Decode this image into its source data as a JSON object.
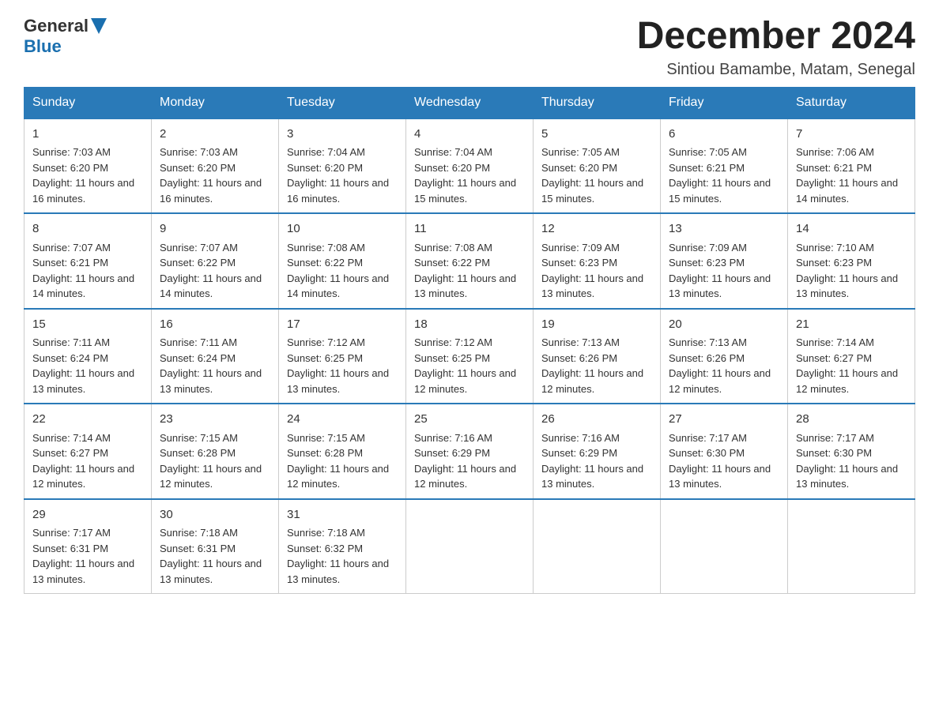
{
  "header": {
    "logo_general": "General",
    "logo_blue": "Blue",
    "month_title": "December 2024",
    "location": "Sintiou Bamambe, Matam, Senegal"
  },
  "columns": [
    "Sunday",
    "Monday",
    "Tuesday",
    "Wednesday",
    "Thursday",
    "Friday",
    "Saturday"
  ],
  "weeks": [
    [
      {
        "day": "1",
        "sunrise": "Sunrise: 7:03 AM",
        "sunset": "Sunset: 6:20 PM",
        "daylight": "Daylight: 11 hours and 16 minutes."
      },
      {
        "day": "2",
        "sunrise": "Sunrise: 7:03 AM",
        "sunset": "Sunset: 6:20 PM",
        "daylight": "Daylight: 11 hours and 16 minutes."
      },
      {
        "day": "3",
        "sunrise": "Sunrise: 7:04 AM",
        "sunset": "Sunset: 6:20 PM",
        "daylight": "Daylight: 11 hours and 16 minutes."
      },
      {
        "day": "4",
        "sunrise": "Sunrise: 7:04 AM",
        "sunset": "Sunset: 6:20 PM",
        "daylight": "Daylight: 11 hours and 15 minutes."
      },
      {
        "day": "5",
        "sunrise": "Sunrise: 7:05 AM",
        "sunset": "Sunset: 6:20 PM",
        "daylight": "Daylight: 11 hours and 15 minutes."
      },
      {
        "day": "6",
        "sunrise": "Sunrise: 7:05 AM",
        "sunset": "Sunset: 6:21 PM",
        "daylight": "Daylight: 11 hours and 15 minutes."
      },
      {
        "day": "7",
        "sunrise": "Sunrise: 7:06 AM",
        "sunset": "Sunset: 6:21 PM",
        "daylight": "Daylight: 11 hours and 14 minutes."
      }
    ],
    [
      {
        "day": "8",
        "sunrise": "Sunrise: 7:07 AM",
        "sunset": "Sunset: 6:21 PM",
        "daylight": "Daylight: 11 hours and 14 minutes."
      },
      {
        "day": "9",
        "sunrise": "Sunrise: 7:07 AM",
        "sunset": "Sunset: 6:22 PM",
        "daylight": "Daylight: 11 hours and 14 minutes."
      },
      {
        "day": "10",
        "sunrise": "Sunrise: 7:08 AM",
        "sunset": "Sunset: 6:22 PM",
        "daylight": "Daylight: 11 hours and 14 minutes."
      },
      {
        "day": "11",
        "sunrise": "Sunrise: 7:08 AM",
        "sunset": "Sunset: 6:22 PM",
        "daylight": "Daylight: 11 hours and 13 minutes."
      },
      {
        "day": "12",
        "sunrise": "Sunrise: 7:09 AM",
        "sunset": "Sunset: 6:23 PM",
        "daylight": "Daylight: 11 hours and 13 minutes."
      },
      {
        "day": "13",
        "sunrise": "Sunrise: 7:09 AM",
        "sunset": "Sunset: 6:23 PM",
        "daylight": "Daylight: 11 hours and 13 minutes."
      },
      {
        "day": "14",
        "sunrise": "Sunrise: 7:10 AM",
        "sunset": "Sunset: 6:23 PM",
        "daylight": "Daylight: 11 hours and 13 minutes."
      }
    ],
    [
      {
        "day": "15",
        "sunrise": "Sunrise: 7:11 AM",
        "sunset": "Sunset: 6:24 PM",
        "daylight": "Daylight: 11 hours and 13 minutes."
      },
      {
        "day": "16",
        "sunrise": "Sunrise: 7:11 AM",
        "sunset": "Sunset: 6:24 PM",
        "daylight": "Daylight: 11 hours and 13 minutes."
      },
      {
        "day": "17",
        "sunrise": "Sunrise: 7:12 AM",
        "sunset": "Sunset: 6:25 PM",
        "daylight": "Daylight: 11 hours and 13 minutes."
      },
      {
        "day": "18",
        "sunrise": "Sunrise: 7:12 AM",
        "sunset": "Sunset: 6:25 PM",
        "daylight": "Daylight: 11 hours and 12 minutes."
      },
      {
        "day": "19",
        "sunrise": "Sunrise: 7:13 AM",
        "sunset": "Sunset: 6:26 PM",
        "daylight": "Daylight: 11 hours and 12 minutes."
      },
      {
        "day": "20",
        "sunrise": "Sunrise: 7:13 AM",
        "sunset": "Sunset: 6:26 PM",
        "daylight": "Daylight: 11 hours and 12 minutes."
      },
      {
        "day": "21",
        "sunrise": "Sunrise: 7:14 AM",
        "sunset": "Sunset: 6:27 PM",
        "daylight": "Daylight: 11 hours and 12 minutes."
      }
    ],
    [
      {
        "day": "22",
        "sunrise": "Sunrise: 7:14 AM",
        "sunset": "Sunset: 6:27 PM",
        "daylight": "Daylight: 11 hours and 12 minutes."
      },
      {
        "day": "23",
        "sunrise": "Sunrise: 7:15 AM",
        "sunset": "Sunset: 6:28 PM",
        "daylight": "Daylight: 11 hours and 12 minutes."
      },
      {
        "day": "24",
        "sunrise": "Sunrise: 7:15 AM",
        "sunset": "Sunset: 6:28 PM",
        "daylight": "Daylight: 11 hours and 12 minutes."
      },
      {
        "day": "25",
        "sunrise": "Sunrise: 7:16 AM",
        "sunset": "Sunset: 6:29 PM",
        "daylight": "Daylight: 11 hours and 12 minutes."
      },
      {
        "day": "26",
        "sunrise": "Sunrise: 7:16 AM",
        "sunset": "Sunset: 6:29 PM",
        "daylight": "Daylight: 11 hours and 13 minutes."
      },
      {
        "day": "27",
        "sunrise": "Sunrise: 7:17 AM",
        "sunset": "Sunset: 6:30 PM",
        "daylight": "Daylight: 11 hours and 13 minutes."
      },
      {
        "day": "28",
        "sunrise": "Sunrise: 7:17 AM",
        "sunset": "Sunset: 6:30 PM",
        "daylight": "Daylight: 11 hours and 13 minutes."
      }
    ],
    [
      {
        "day": "29",
        "sunrise": "Sunrise: 7:17 AM",
        "sunset": "Sunset: 6:31 PM",
        "daylight": "Daylight: 11 hours and 13 minutes."
      },
      {
        "day": "30",
        "sunrise": "Sunrise: 7:18 AM",
        "sunset": "Sunset: 6:31 PM",
        "daylight": "Daylight: 11 hours and 13 minutes."
      },
      {
        "day": "31",
        "sunrise": "Sunrise: 7:18 AM",
        "sunset": "Sunset: 6:32 PM",
        "daylight": "Daylight: 11 hours and 13 minutes."
      },
      null,
      null,
      null,
      null
    ]
  ]
}
